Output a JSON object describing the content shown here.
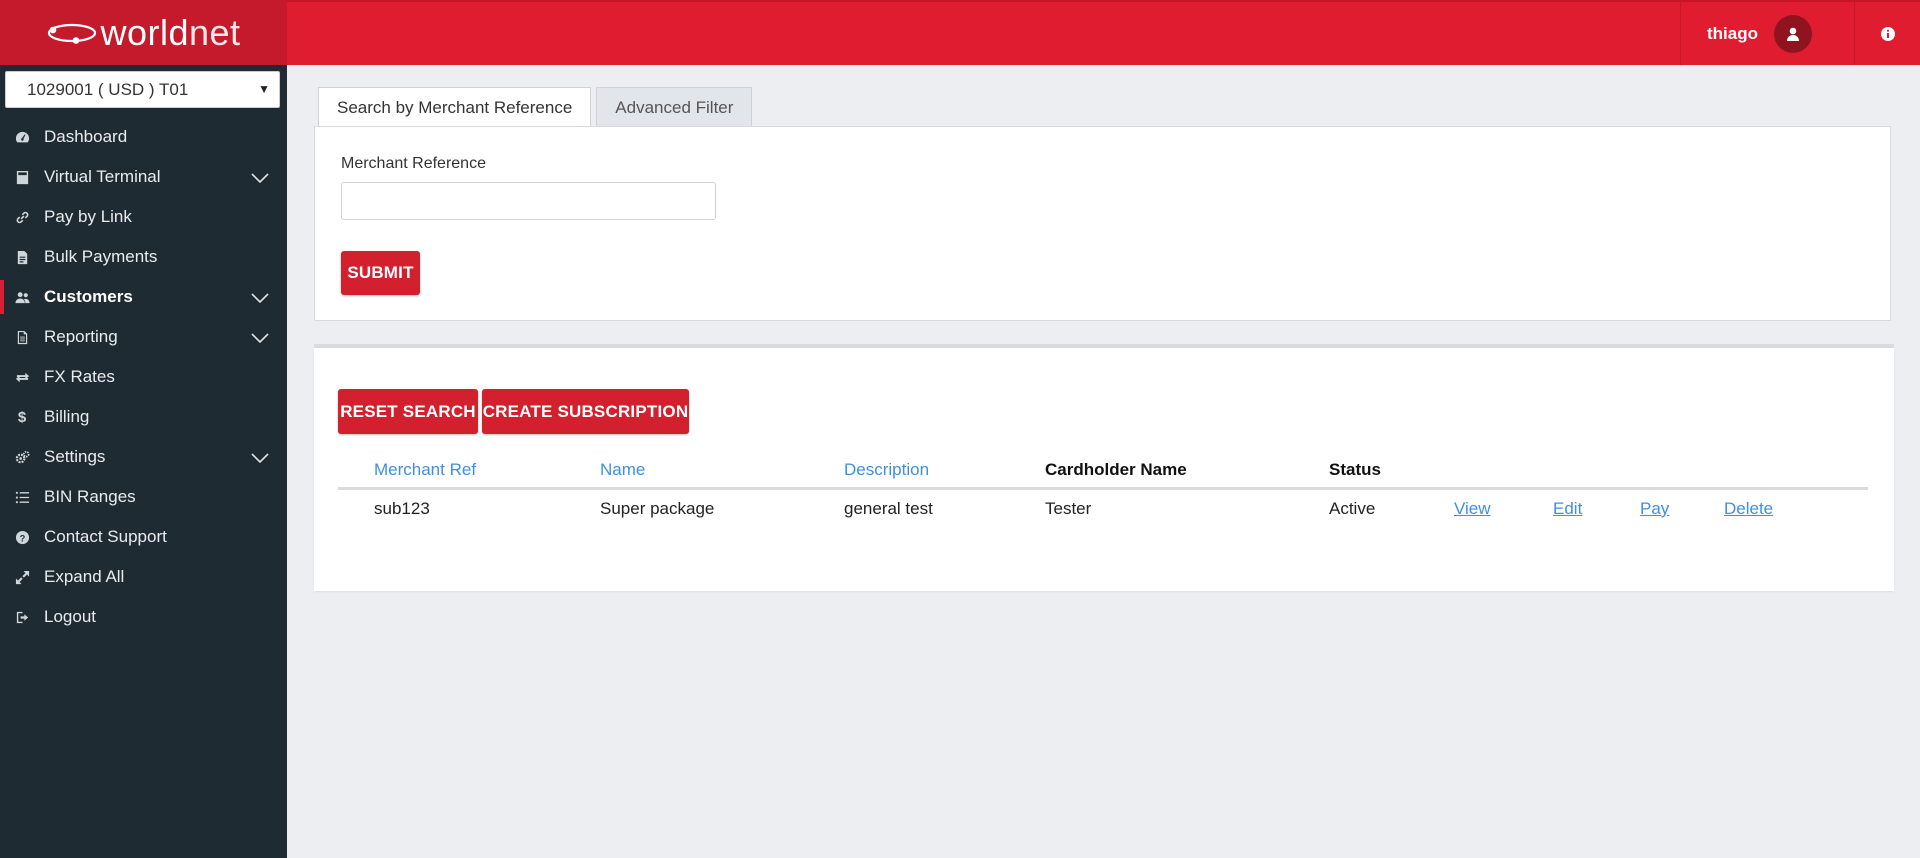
{
  "brand": {
    "name_part1": "world",
    "name_part2": "net"
  },
  "merchant_selector": {
    "value": "1029001 ( USD ) T01",
    "caret": "▼"
  },
  "sidebar": {
    "items": [
      {
        "label": "Dashboard",
        "icon": "dashboard-icon",
        "expandable": false,
        "active": false
      },
      {
        "label": "Virtual Terminal",
        "icon": "calculator-icon",
        "expandable": true,
        "active": false
      },
      {
        "label": "Pay by Link",
        "icon": "link-icon",
        "expandable": false,
        "active": false
      },
      {
        "label": "Bulk Payments",
        "icon": "file-icon",
        "expandable": false,
        "active": false
      },
      {
        "label": "Customers",
        "icon": "users-icon",
        "expandable": true,
        "active": true
      },
      {
        "label": "Reporting",
        "icon": "report-icon",
        "expandable": true,
        "active": false
      },
      {
        "label": "FX Rates",
        "icon": "exchange-icon",
        "expandable": false,
        "active": false
      },
      {
        "label": "Billing",
        "icon": "dollar-icon",
        "expandable": false,
        "active": false
      },
      {
        "label": "Settings",
        "icon": "cogs-icon",
        "expandable": true,
        "active": false
      },
      {
        "label": "BIN Ranges",
        "icon": "list-icon",
        "expandable": false,
        "active": false
      },
      {
        "label": "Contact Support",
        "icon": "question-icon",
        "expandable": false,
        "active": false
      },
      {
        "label": "Expand All",
        "icon": "expand-icon",
        "expandable": false,
        "active": false
      },
      {
        "label": "Logout",
        "icon": "logout-icon",
        "expandable": false,
        "active": false
      }
    ]
  },
  "header": {
    "username": "thiago",
    "user_icon": "user-icon",
    "info_icon": "info-icon"
  },
  "tabs": [
    {
      "label": "Search by Merchant Reference",
      "active": true
    },
    {
      "label": "Advanced Filter",
      "active": false
    }
  ],
  "search": {
    "field_label": "Merchant Reference",
    "value": "",
    "placeholder": "",
    "submit_label": "SUBMIT"
  },
  "actions": {
    "reset_label": "RESET SEARCH",
    "create_label": "CREATE SUBSCRIPTION"
  },
  "table": {
    "columns": [
      "Merchant Ref",
      "Name",
      "Description",
      "Cardholder Name",
      "Status"
    ],
    "rows": [
      {
        "merchant_ref": "sub123",
        "name": "Super package",
        "description": "general test",
        "cardholder_name": "Tester",
        "status": "Active",
        "actions": [
          "View",
          "Edit",
          "Pay",
          "Delete"
        ]
      }
    ]
  },
  "colors": {
    "brand_red": "#e01c30",
    "sidebar_bg": "#1f2b33",
    "link_blue": "#3d8fe3",
    "button_red": "#d3202f"
  }
}
